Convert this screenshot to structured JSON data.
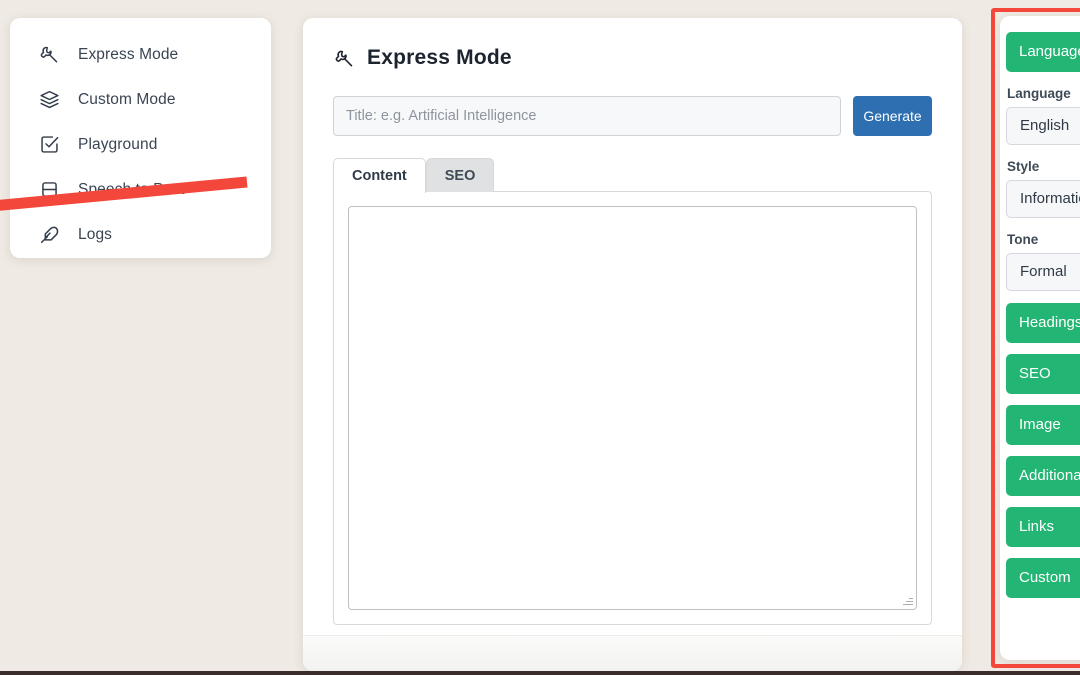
{
  "theme": {
    "page_background": "#efeae3",
    "accent_green": "#22b573",
    "accent_blue": "#2d6fb0",
    "annotation_red": "#f4473b",
    "text_dark": "#3a4553"
  },
  "sidebar": {
    "items": [
      {
        "label": "Express Mode",
        "icon": "wrench-icon"
      },
      {
        "label": "Custom Mode",
        "icon": "layers-icon"
      },
      {
        "label": "Playground",
        "icon": "checkbox-check-icon"
      },
      {
        "label": "Speech to Post",
        "icon": "database-icon"
      },
      {
        "label": "Logs",
        "icon": "feather-pen-icon"
      }
    ]
  },
  "main": {
    "title": "Express Mode",
    "title_icon": "wrench-icon",
    "title_input": {
      "value": "",
      "placeholder": "Title: e.g. Artificial Intelligence"
    },
    "generate_label": "Generate",
    "tabs": [
      {
        "label": "Content",
        "active": true
      },
      {
        "label": "SEO",
        "active": false
      }
    ],
    "content_textarea": {
      "value": "",
      "placeholder": ""
    }
  },
  "right_panel": {
    "top_button": "Language",
    "fields": [
      {
        "label": "Language",
        "value": "English"
      },
      {
        "label": "Style",
        "value": "Informational"
      },
      {
        "label": "Tone",
        "value": "Formal"
      }
    ],
    "buttons": [
      "Headings",
      "SEO",
      "Image",
      "Additional",
      "Links",
      "Custom"
    ]
  },
  "annotations": {
    "highlight_box": "right-panel-highlight",
    "arrow_points_to": "Speech to Post"
  }
}
